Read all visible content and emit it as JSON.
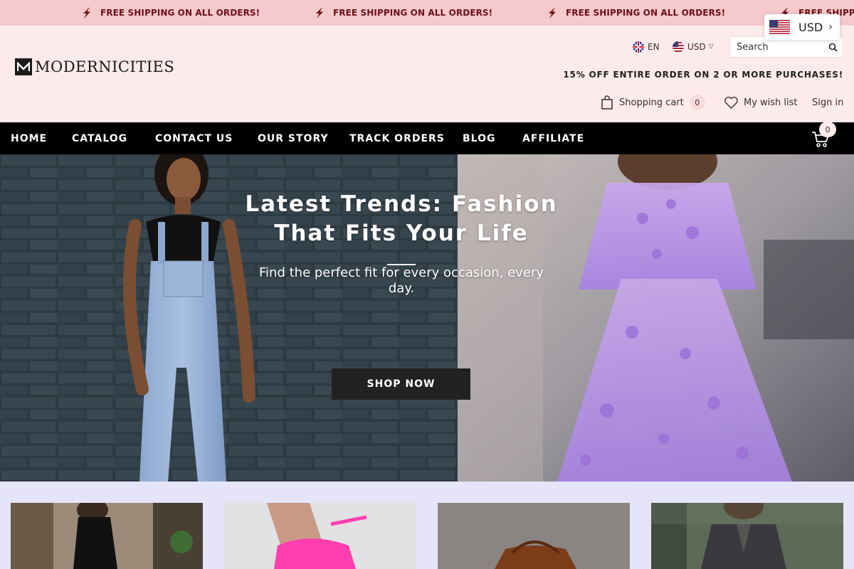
{
  "announcement": {
    "items": [
      "FREE SHIPPING ON ALL ORDERS!",
      "FREE SHIPPING ON ALL ORDERS!",
      "FREE SHIPPING ON ALL ORDERS!",
      "FREE SHIPPING ON ALL ORDERS!"
    ],
    "color": "#6b1118",
    "background": "#f6c9cc"
  },
  "currency_popup": {
    "label": "USD"
  },
  "header": {
    "logo_text": "MODERNICITIES",
    "language": "EN",
    "currency": "USD",
    "search_placeholder": "Search",
    "promo": "15% OFF ENTIRE ORDER ON 2 OR MORE PURCHASES!",
    "cart_label": "Shopping cart",
    "cart_count": "0",
    "wishlist_label": "My wish list",
    "signin_label": "Sign in",
    "background": "#fdeaea"
  },
  "nav": {
    "items": [
      "HOME",
      "CATALOG",
      "CONTACT US",
      "OUR STORY",
      "TRACK ORDERS",
      "BLOG",
      "AFFILIATE"
    ],
    "cart_badge": "0",
    "background": "#000000"
  },
  "hero": {
    "title": "Latest Trends: Fashion That Fits Your Life",
    "subtitle": "Find the perfect fit for every occasion, every day.",
    "button": "SHOP NOW"
  },
  "categories": {
    "background": "#e5e4f8",
    "cards": [
      "black-dress-photo",
      "pink-heels-photo",
      "brown-bag-photo",
      "grey-suit-photo"
    ]
  }
}
